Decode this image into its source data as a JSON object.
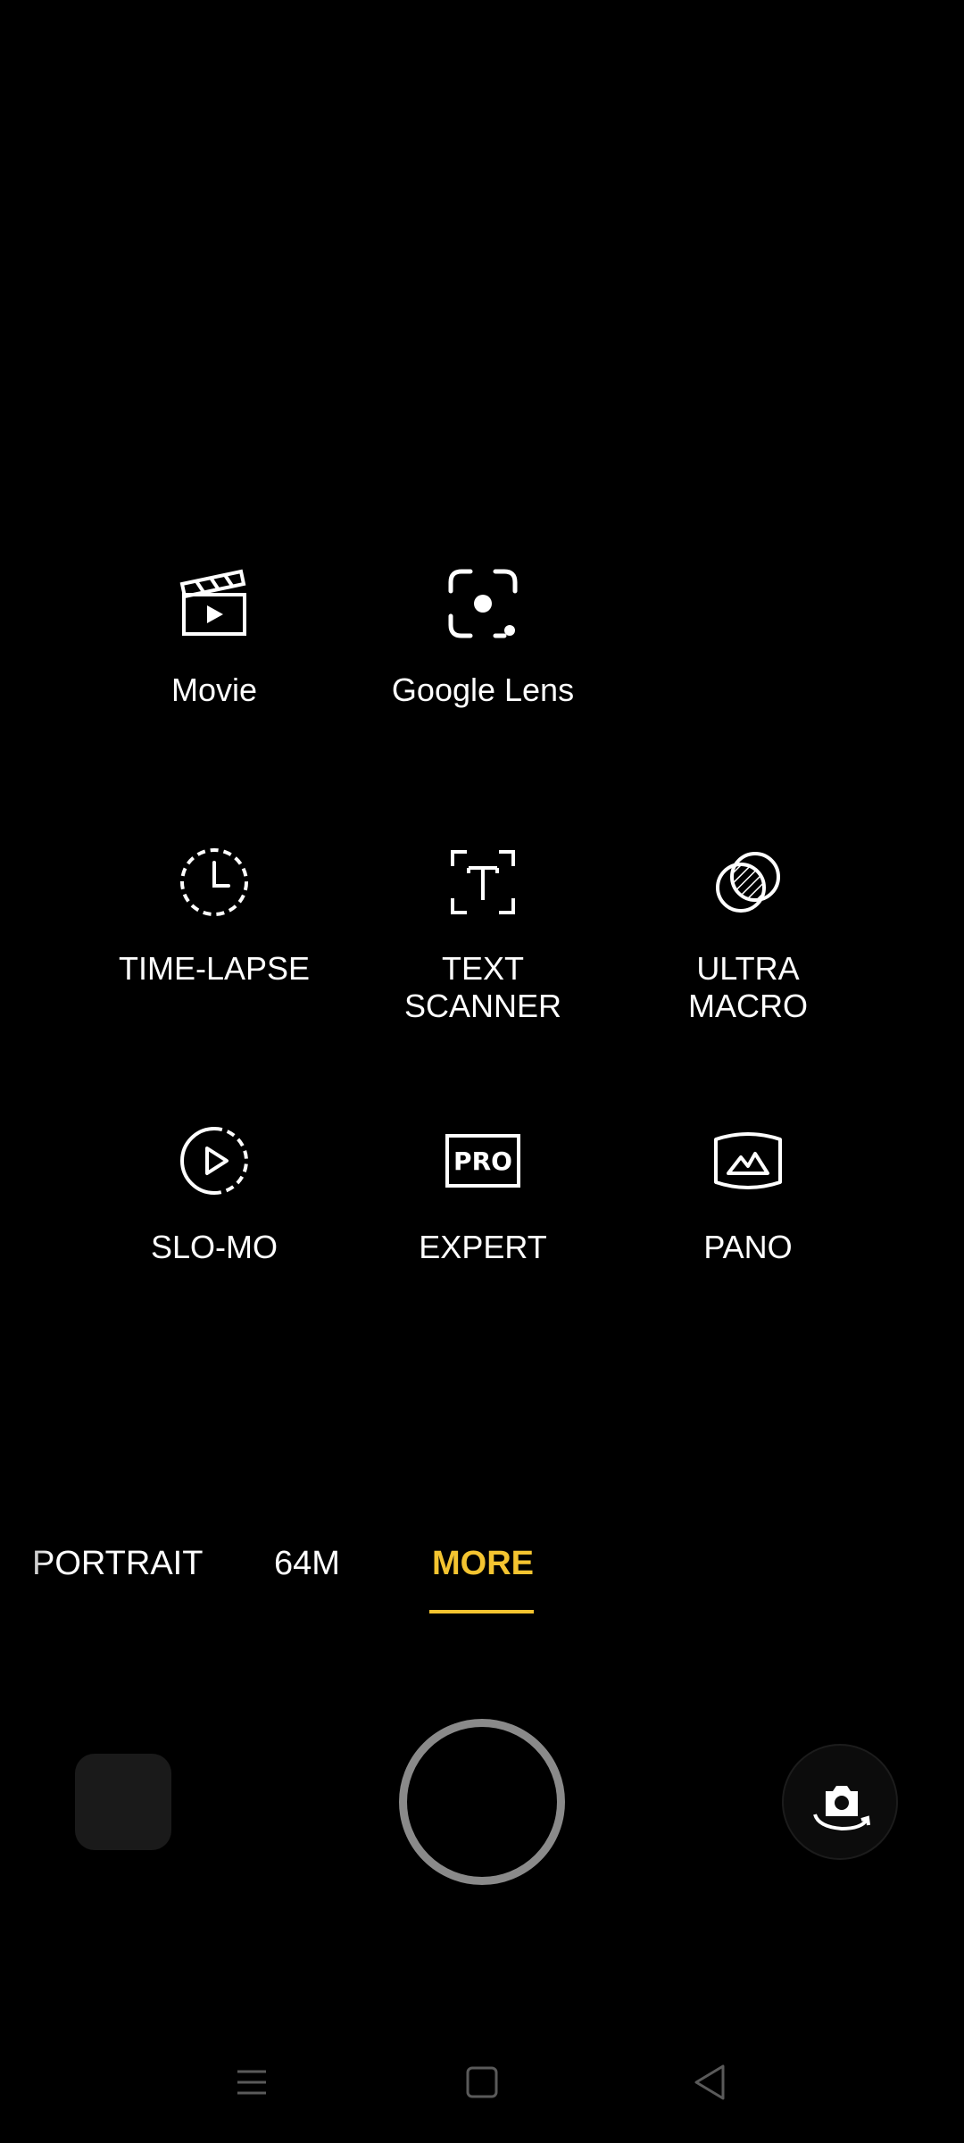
{
  "modes_grid": [
    {
      "id": "movie",
      "label": "Movie",
      "icon": "clapperboard-icon"
    },
    {
      "id": "google-lens",
      "label": "Google Lens",
      "icon": "google-lens-icon"
    },
    {
      "id": "time-lapse",
      "label": "TIME-LAPSE",
      "icon": "timelapse-clock-icon"
    },
    {
      "id": "text-scanner",
      "label": "TEXT\nSCANNER",
      "icon": "text-scan-icon"
    },
    {
      "id": "ultra-macro",
      "label": "ULTRA\nMACRO",
      "icon": "macro-lens-icon"
    },
    {
      "id": "slo-mo",
      "label": "SLO-MO",
      "icon": "slow-motion-icon"
    },
    {
      "id": "expert",
      "label": "EXPERT",
      "icon": "pro-mode-icon"
    },
    {
      "id": "pano",
      "label": "PANO",
      "icon": "panorama-icon"
    }
  ],
  "mode_bar": {
    "items": [
      "PORTRAIT",
      "64M",
      "MORE"
    ],
    "active": "MORE",
    "active_color": "#f4c430"
  },
  "controls": {
    "gallery_icon": "gallery-thumbnail-icon",
    "shutter_icon": "shutter-button-icon",
    "flip_icon": "flip-camera-icon"
  },
  "nav_bar": {
    "recents_icon": "menu-icon",
    "home_icon": "home-square-icon",
    "back_icon": "back-triangle-icon"
  }
}
